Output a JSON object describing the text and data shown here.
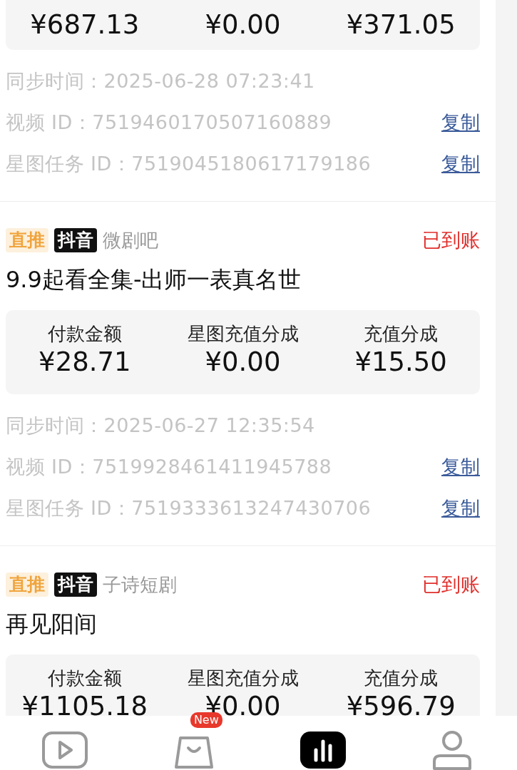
{
  "records": [
    {
      "stats": [
        {
          "value": "¥687.13"
        },
        {
          "value": "¥0.00"
        },
        {
          "value": "¥371.05"
        }
      ],
      "meta": [
        {
          "label": "同步时间：",
          "value": "2025-06-28 07:23:41"
        },
        {
          "label": "视频 ID：",
          "value": "7519460170507160889",
          "action": "复制"
        },
        {
          "label": "星图任务 ID：",
          "value": "7519045180617179186",
          "action": "复制"
        }
      ]
    },
    {
      "tags": [
        {
          "kind": "promo",
          "text": "直推"
        },
        {
          "kind": "platform",
          "text": "抖音"
        }
      ],
      "source": "微剧吧",
      "status": "已到账",
      "title": "9.9起看全集-出师一表真名世",
      "stats": [
        {
          "label": "付款金额",
          "value": "¥28.71"
        },
        {
          "label": "星图充值分成",
          "value": "¥0.00"
        },
        {
          "label": "充值分成",
          "value": "¥15.50"
        }
      ],
      "meta": [
        {
          "label": "同步时间：",
          "value": "2025-06-27 12:35:54"
        },
        {
          "label": "视频 ID：",
          "value": "7519928461411945788",
          "action": "复制"
        },
        {
          "label": "星图任务 ID：",
          "value": "7519333613247430706",
          "action": "复制"
        }
      ]
    },
    {
      "tags": [
        {
          "kind": "promo",
          "text": "直推"
        },
        {
          "kind": "platform",
          "text": "抖音"
        }
      ],
      "source": "子诗短剧",
      "status": "已到账",
      "title": "再见阳间",
      "stats": [
        {
          "label": "付款金额",
          "value": "¥1105.18"
        },
        {
          "label": "星图充值分成",
          "value": "¥0.00"
        },
        {
          "label": "充值分成",
          "value": "¥596.79"
        }
      ]
    }
  ],
  "tab_bar": {
    "items": [
      {
        "kind": "video",
        "selected": false
      },
      {
        "kind": "shop",
        "selected": false,
        "badge": "New"
      },
      {
        "kind": "data",
        "selected": true
      },
      {
        "kind": "profile",
        "selected": false
      }
    ]
  }
}
